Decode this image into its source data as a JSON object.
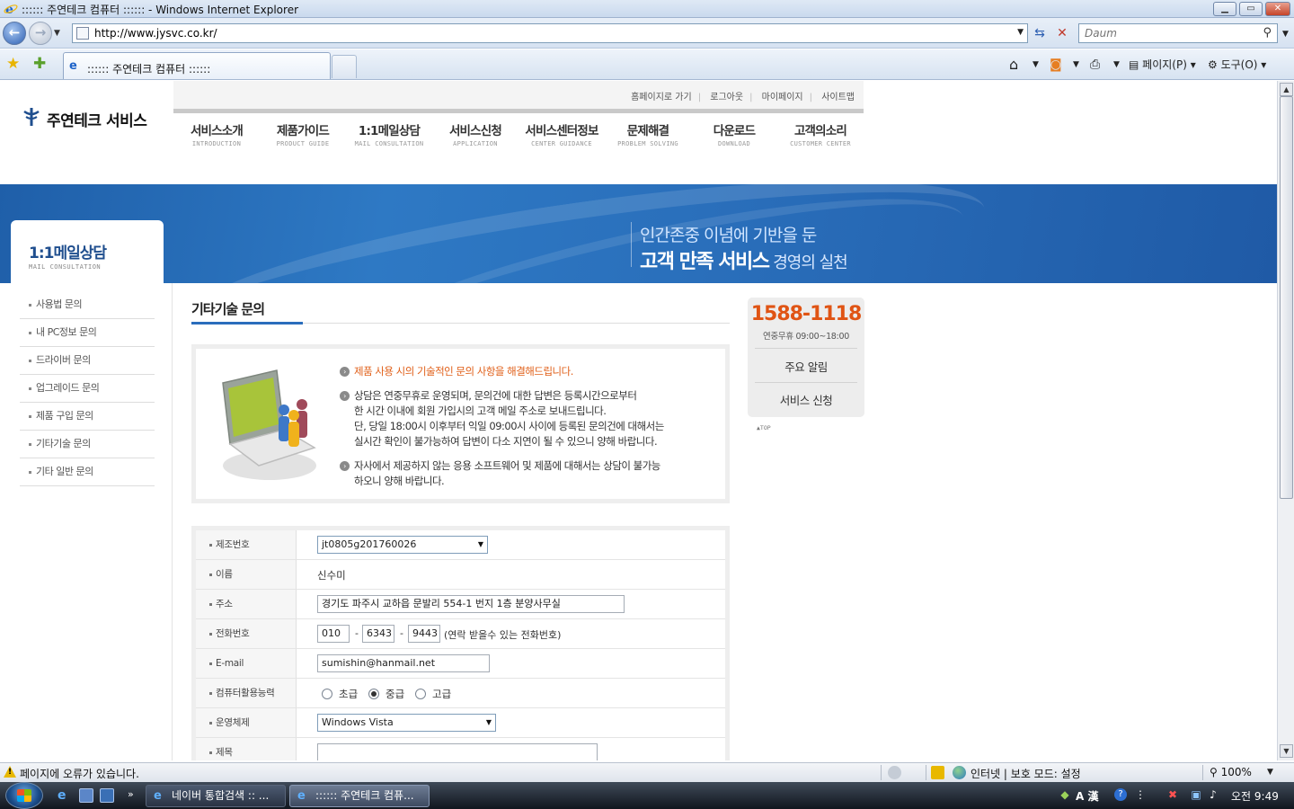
{
  "window": {
    "title": ":::::: 주연테크 컴퓨터 :::::: - Windows Internet Explorer",
    "min": "▁",
    "max": "▭",
    "close": "✕"
  },
  "address": {
    "url": "http://www.jysvc.co.kr/",
    "search_placeholder": "Daum"
  },
  "tabs": [
    {
      "label": ":::::: 주연테크 컴퓨터 ::::::"
    }
  ],
  "commands": {
    "page": "페이지(P)",
    "tools": "도구(O)"
  },
  "site": {
    "logo_text": "주연테크 서비스",
    "util_links": [
      "홈페이지로 가기",
      "로그아웃",
      "마이페이지",
      "사이트맵"
    ],
    "gnb": [
      {
        "ko": "서비스소개",
        "en": "INTRODUCTION"
      },
      {
        "ko": "제품가이드",
        "en": "PRODUCT GUIDE"
      },
      {
        "ko": "1:1메일상담",
        "en": "MAIL CONSULTATION"
      },
      {
        "ko": "서비스신청",
        "en": "APPLICATION"
      },
      {
        "ko": "서비스센터정보",
        "en": "CENTER GUIDANCE"
      },
      {
        "ko": "문제해결",
        "en": "PROBLEM SOLVING"
      },
      {
        "ko": "다운로드",
        "en": "DOWNLOAD"
      },
      {
        "ko": "고객의소리",
        "en": "CUSTOMER CENTER"
      }
    ],
    "banner": {
      "line1": "인간존중 이념에 기반을 둔",
      "line2_bold": "고객 만족 서비스",
      "line2_light": " 경영의 실천"
    }
  },
  "sidebar": {
    "title": "1:1메일상담",
    "subtitle": "MAIL CONSULTATION",
    "items": [
      {
        "label": "사용법 문의"
      },
      {
        "label": "내 PC정보 문의"
      },
      {
        "label": "드라이버 문의"
      },
      {
        "label": "업그레이드 문의"
      },
      {
        "label": "제품 구입 문의"
      },
      {
        "label": "기타기술 문의"
      },
      {
        "label": "기타 일반 문의"
      }
    ],
    "active_index": 5
  },
  "content": {
    "title": "기타기술 문의",
    "info": [
      {
        "lines": [
          "제품 사용 시의 기술적인 문의 사항을 해결해드립니다."
        ],
        "highlight": true
      },
      {
        "lines": [
          "상담은 연중무휴로 운영되며, 문의건에 대한 답변은 등록시간으로부터",
          "한 시간 이내에 회원 가입시의 고객 메일 주소로 보내드립니다.",
          "단, 당일 18:00시 이후부터 익일 09:00시 사이에 등록된 문의건에 대해서는",
          "실시간 확인이 불가능하여 답변이 다소 지연이 될 수 있으니 양해 바랍니다."
        ],
        "highlight": false
      },
      {
        "lines": [
          "자사에서 제공하지 않는 응용 소프트웨어 및 제품에 대해서는 상담이 불가능",
          "하오니 양해 바랍니다."
        ],
        "highlight": false
      }
    ],
    "form": {
      "serial_label": "제조번호",
      "serial_value": "jt0805g201760026",
      "name_label": "이름",
      "name_value": "신수미",
      "address_label": "주소",
      "address_value": "경기도 파주시 교하읍 문발리 554-1 번지 1층 분양사무실",
      "phone_label": "전화번호",
      "phone": [
        "010",
        "6343",
        "9443"
      ],
      "phone_dash": "-",
      "phone_note": "(연락 받을수 있는 전화번호)",
      "email_label": "E-mail",
      "email_value": "sumishin@hanmail.net",
      "skill_label": "컴퓨터활용능력",
      "skill_options": [
        "초급",
        "중급",
        "고급"
      ],
      "skill_selected": 1,
      "os_label": "운영체제",
      "os_value": "Windows Vista",
      "subject_label": "제목",
      "subject_value": ""
    }
  },
  "quick": {
    "tel": "1588-1118",
    "hours": "연중무휴 09:00~18:00",
    "notice": "주요 알림",
    "apply": "서비스 신청",
    "top": "▲TOP"
  },
  "status": {
    "message": "페이지에 오류가 있습니다.",
    "zone": "인터넷 | 보호 모드: 설정",
    "zoom": "100%"
  },
  "taskbar": {
    "tasks": [
      {
        "label": "네이버 통합검색 :: ..."
      },
      {
        "label": ":::::: 주연테크 컴퓨..."
      }
    ],
    "ime": "A 漢",
    "clock": "오전 9:49"
  }
}
